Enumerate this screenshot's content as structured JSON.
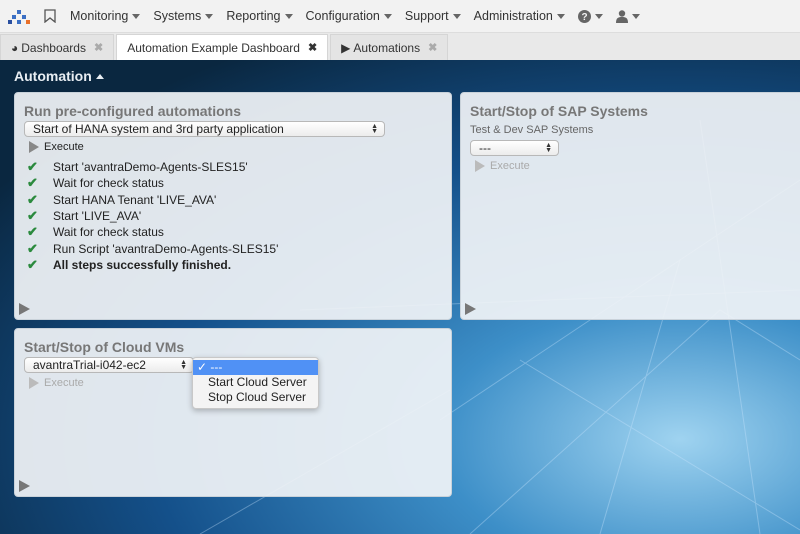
{
  "nav": {
    "items": [
      {
        "label": "Monitoring"
      },
      {
        "label": "Systems"
      },
      {
        "label": "Reporting"
      },
      {
        "label": "Configuration"
      },
      {
        "label": "Support"
      },
      {
        "label": "Administration"
      }
    ],
    "icons": [
      "logo",
      "bookmark-icon",
      "help-icon",
      "user-icon"
    ]
  },
  "tabs": [
    {
      "label": "Dashboards",
      "icon": "dashboard-icon"
    },
    {
      "label": "Automation Example Dashboard"
    },
    {
      "label": "Automations",
      "icon": "play-icon"
    }
  ],
  "section": {
    "title": "Automation"
  },
  "panel1": {
    "title": "Run pre-configured automations",
    "select_value": "Start of HANA system and 3rd party application",
    "execute": "Execute",
    "steps": [
      "Start 'avantraDemo-Agents-SLES15'",
      "Wait for check status",
      "Start HANA Tenant 'LIVE_AVA'",
      "Start 'LIVE_AVA'",
      "Wait for check status",
      "Run Script 'avantraDemo-Agents-SLES15'",
      "All steps successfully finished."
    ]
  },
  "panel2": {
    "title": "Start/Stop of SAP Systems",
    "subtitle": "Test & Dev SAP Systems",
    "select_value": "---",
    "execute": "Execute"
  },
  "panel3": {
    "title": "Start/Stop of Cloud VMs",
    "select_value": "avantraTrial-i042-ec2",
    "execute": "Execute",
    "dropdown": {
      "options": [
        "✓ ---",
        "Start Cloud Server",
        "Stop Cloud Server"
      ],
      "selected": "---"
    }
  },
  "colors": {
    "check": "#2b8a3e",
    "selected_option": "#5091f5",
    "background": "#14508a"
  }
}
